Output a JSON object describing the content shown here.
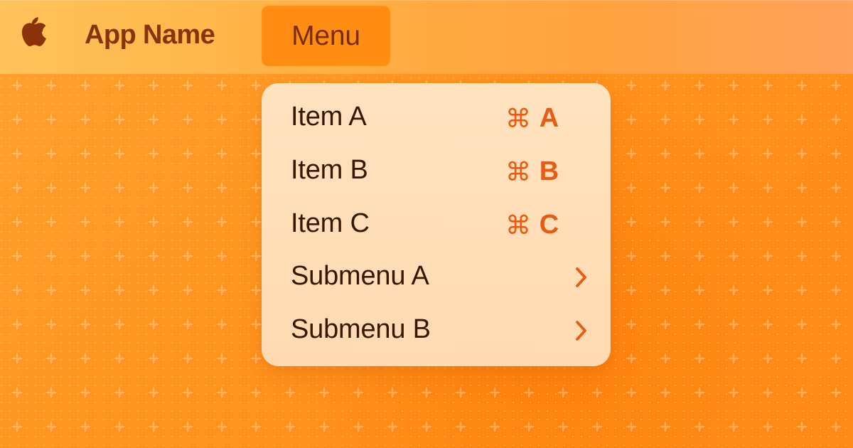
{
  "window": {
    "app_name": "App Name",
    "menu_label": "Menu"
  },
  "menu": {
    "items": [
      {
        "label": "Item A",
        "shortcut_symbol": "⌘",
        "shortcut_key": "A"
      },
      {
        "label": "Item B",
        "shortcut_symbol": "⌘",
        "shortcut_key": "B"
      },
      {
        "label": "Item C",
        "shortcut_symbol": "⌘",
        "shortcut_key": "C"
      },
      {
        "label": "Submenu A",
        "icon": "chevron-right-icon"
      },
      {
        "label": "Submenu B",
        "icon": "chevron-right-icon"
      }
    ]
  },
  "icons": {
    "apple_logo": "apple-logo-icon"
  },
  "colors": {
    "accent": "#ff8d13",
    "text_dark": "#3a1600",
    "shortcut": "#ea5a12"
  }
}
